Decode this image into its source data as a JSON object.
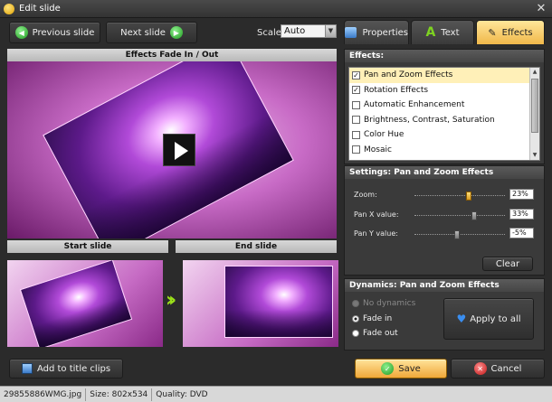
{
  "window": {
    "title": "Edit slide",
    "close_symbol": "✕"
  },
  "toolbar": {
    "prev_label": "Previous slide",
    "next_label": "Next slide",
    "scale_label": "Scale:",
    "scale_value": "Auto"
  },
  "preview": {
    "header": "Effects Fade In / Out"
  },
  "thumbnails": {
    "start_label": "Start slide",
    "end_label": "End slide"
  },
  "tabs": [
    {
      "label": "Properties",
      "icon": "properties-icon",
      "active": false
    },
    {
      "label": "Text",
      "icon": "text-icon",
      "active": false
    },
    {
      "label": "Effects",
      "icon": "effects-icon",
      "active": true
    }
  ],
  "effects_panel": {
    "title": "Effects:",
    "items": [
      {
        "label": "Pan and Zoom Effects",
        "checked": true,
        "selected": true
      },
      {
        "label": "Rotation Effects",
        "checked": true,
        "selected": false
      },
      {
        "label": "Automatic Enhancement",
        "checked": false,
        "selected": false
      },
      {
        "label": "Brightness, Contrast, Saturation",
        "checked": false,
        "selected": false
      },
      {
        "label": "Color Hue",
        "checked": false,
        "selected": false
      },
      {
        "label": "Mosaic",
        "checked": false,
        "selected": false
      }
    ]
  },
  "settings": {
    "title": "Settings: Pan and Zoom Effects",
    "zoom_label": "Zoom:",
    "zoom_value": "23%",
    "zoom_level": 0.6,
    "panx_label": "Pan X value:",
    "panx_value": "33%",
    "panx_level": 0.66,
    "pany_label": "Pan Y value:",
    "pany_value": "-5%",
    "pany_level": 0.47,
    "clear_label": "Clear"
  },
  "dynamics": {
    "title": "Dynamics: Pan and Zoom Effects",
    "options": [
      {
        "label": "No dynamics",
        "checked": false,
        "disabled": true
      },
      {
        "label": "Fade in",
        "checked": true,
        "disabled": false
      },
      {
        "label": "Fade out",
        "checked": false,
        "disabled": false
      }
    ],
    "apply_label": "Apply to all"
  },
  "footer": {
    "add_title_label": "Add to title clips",
    "save_label": "Save",
    "cancel_label": "Cancel"
  },
  "status": {
    "filename": "29855886WMG.jpg",
    "size": "Size: 802x534",
    "quality": "Quality: DVD"
  },
  "colors": {
    "accent": "#f0b84a",
    "background": "#2b2b2b"
  }
}
